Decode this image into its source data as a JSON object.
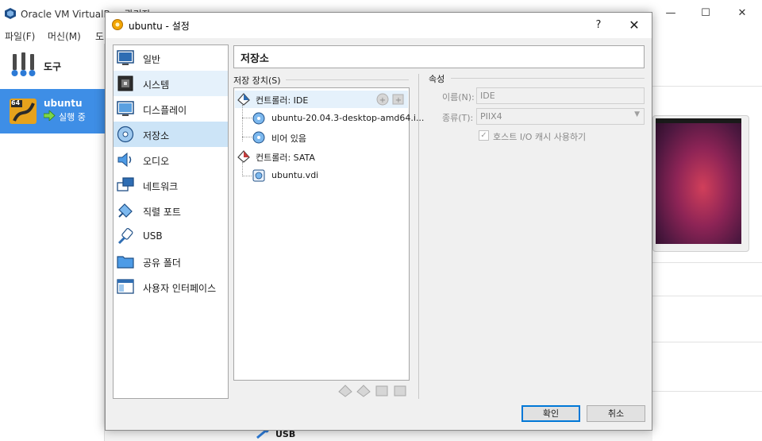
{
  "background": {
    "title": "Oracle VM VirtualBox 관리자",
    "menu": [
      "파일(F)",
      "머신(M)",
      "도"
    ],
    "sidebar": {
      "tools_label": "도구",
      "vm": {
        "name": "ubuntu",
        "state": "실행 중",
        "os_badge": "64"
      }
    },
    "details": {
      "usb_label": "USB"
    }
  },
  "dialog": {
    "title": "ubuntu - 설정",
    "help_label": "?",
    "close_label": "✕",
    "nav": [
      {
        "label": "일반",
        "icon": "general-icon"
      },
      {
        "label": "시스템",
        "icon": "system-icon"
      },
      {
        "label": "디스플레이",
        "icon": "display-icon"
      },
      {
        "label": "저장소",
        "icon": "storage-icon"
      },
      {
        "label": "오디오",
        "icon": "audio-icon"
      },
      {
        "label": "네트워크",
        "icon": "network-icon"
      },
      {
        "label": "직렬 포트",
        "icon": "serial-port-icon"
      },
      {
        "label": "USB",
        "icon": "usb-icon"
      },
      {
        "label": "공유 폴더",
        "icon": "shared-folder-icon"
      },
      {
        "label": "사용자 인터페이스",
        "icon": "user-interface-icon"
      }
    ],
    "selected_nav": "저장소",
    "page_title": "저장소",
    "storage": {
      "group_label": "저장 장치(S)",
      "controllers": [
        {
          "label": "컨트롤러: IDE",
          "attachments": [
            {
              "label": "ubuntu-20.04.3-desktop-amd64.i...",
              "type": "optical"
            },
            {
              "label": "비어 있음",
              "type": "optical"
            }
          ]
        },
        {
          "label": "컨트롤러: SATA",
          "attachments": [
            {
              "label": "ubuntu.vdi",
              "type": "hard-disk"
            }
          ]
        }
      ]
    },
    "attributes": {
      "group_label": "속성",
      "name_label": "이름(N):",
      "name_value": "IDE",
      "type_label": "종류(T):",
      "type_value": "PIIX4",
      "cache_label": "호스트 I/O 캐시 사용하기",
      "cache_checked": true
    },
    "buttons": {
      "ok": "확인",
      "cancel": "취소"
    }
  }
}
